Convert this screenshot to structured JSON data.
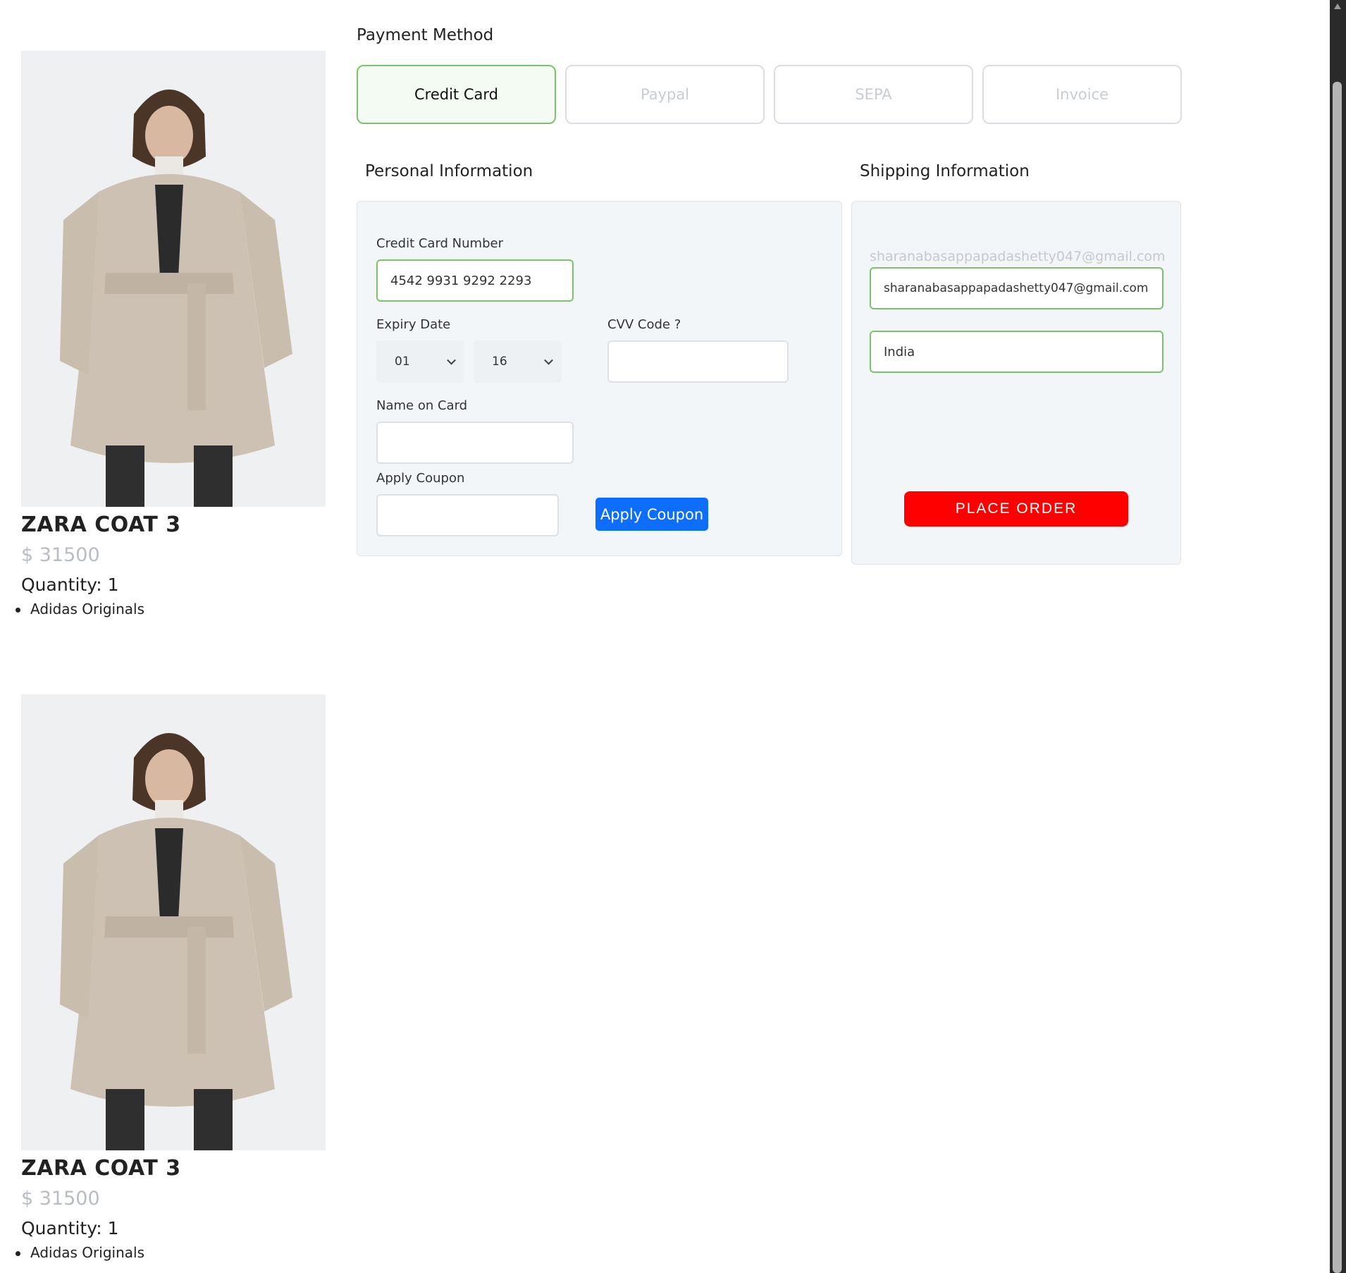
{
  "products": [
    {
      "image_alt": "ZARA COAT 3 product image",
      "title": "ZARA COAT 3",
      "price": "$ 31500",
      "quantity": "Quantity: 1",
      "brands": [
        "Adidas Originals"
      ]
    },
    {
      "image_alt": "ZARA COAT 3 product image",
      "title": "ZARA COAT 3",
      "price": "$ 31500",
      "quantity": "Quantity: 1",
      "brands": [
        "Adidas Originals"
      ]
    }
  ],
  "payment": {
    "title": "Payment Method",
    "methods": [
      "Credit Card",
      "Paypal",
      "SEPA",
      "Invoice"
    ],
    "active_method": "Credit Card"
  },
  "personal": {
    "title": "Personal Information",
    "card_number_label": "Credit Card Number",
    "card_number_value": "4542 9931 9292 2293",
    "expiry_label": "Expiry Date",
    "expiry_month": "01",
    "expiry_year": "16",
    "cvv_label": "CVV Code ?",
    "cvv_value": "",
    "name_label": "Name on Card",
    "name_value": "",
    "coupon_label": "Apply Coupon",
    "coupon_value": "",
    "coupon_button": "Apply Coupon"
  },
  "shipping": {
    "title": "Shipping Information",
    "email_hint": "sharanabasappapadashetty047@gmail.com",
    "email_value": "sharanabasappapadashetty047@gmail.com",
    "country_value": "India",
    "place_order": "PLACE ORDER"
  },
  "colors": {
    "accent_green": "#7ac36b",
    "apply_blue": "#0d6efd",
    "order_red": "#ff0000",
    "panel_bg": "#f3f6f9"
  }
}
